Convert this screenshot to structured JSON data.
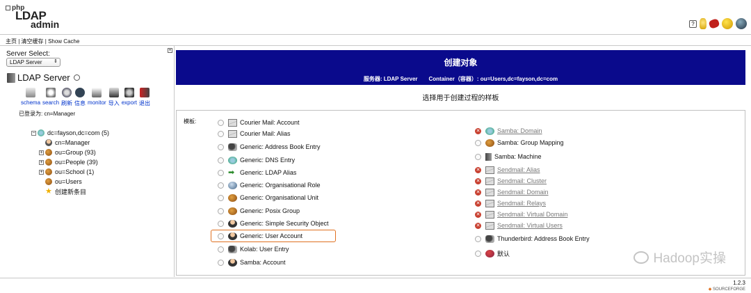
{
  "header": {
    "logo_line1": "php",
    "logo_line2": "LDAP",
    "logo_line3": "admin",
    "icons": [
      "help-icon",
      "bulb-icon",
      "bug-icon",
      "smile-icon",
      "support-icon"
    ]
  },
  "topnav": {
    "home": "主页",
    "sep1": " | ",
    "purge": "清空缓存",
    "sep2": " | ",
    "show_cache": "Show Cache"
  },
  "left": {
    "server_select_label": "Server Select:",
    "server_select_value": "LDAP Server",
    "server_name": "LDAP Server",
    "tools": [
      {
        "label": "schema",
        "icon": "schema-icon"
      },
      {
        "label": "search",
        "icon": "search-icon"
      },
      {
        "label": "刷新",
        "icon": "refresh-icon"
      },
      {
        "label": "信息",
        "icon": "info-icon"
      },
      {
        "label": "monitor",
        "icon": "monitor-icon"
      },
      {
        "label": "导入",
        "icon": "import-icon"
      },
      {
        "label": "export",
        "icon": "export-icon"
      },
      {
        "label": "退出",
        "icon": "logout-icon"
      }
    ],
    "logged_in": "已登录为: cn=Manager",
    "tree": {
      "root": "dc=fayson,dc=com (5)",
      "items": [
        {
          "label": "cn=Manager",
          "expandable": false,
          "icon": "user-icon"
        },
        {
          "label": "ou=Group (93)",
          "expandable": true,
          "icon": "group-icon"
        },
        {
          "label": "ou=People (39)",
          "expandable": true,
          "icon": "group-icon"
        },
        {
          "label": "ou=School (1)",
          "expandable": true,
          "icon": "group-icon"
        },
        {
          "label": "ou=Users",
          "expandable": false,
          "icon": "group-icon"
        },
        {
          "label": "创建新条目",
          "expandable": false,
          "icon": "star-icon"
        }
      ]
    }
  },
  "main": {
    "title": "创建对象",
    "server_info": "服务器: LDAP Server　　Container（容器）: ou=Users,dc=fayson,dc=com",
    "subtitle": "选择用于创建过程的样板",
    "template_label": "模板:",
    "left_templates": [
      {
        "label": "Courier Mail: Account",
        "icon": "mail-icon"
      },
      {
        "label": "Courier Mail: Alias",
        "icon": "mail-icon"
      },
      {
        "label": "Generic: Address Book Entry",
        "icon": "addressbook-icon"
      },
      {
        "label": "Generic: DNS Entry",
        "icon": "dns-icon"
      },
      {
        "label": "Generic: LDAP Alias",
        "icon": "arrow-icon"
      },
      {
        "label": "Generic: Organisational Role",
        "icon": "globe-icon"
      },
      {
        "label": "Generic: Organisational Unit",
        "icon": "group-icon"
      },
      {
        "label": "Generic: Posix Group",
        "icon": "group-icon"
      },
      {
        "label": "Generic: Simple Security Object",
        "icon": "user-icon"
      },
      {
        "label": "Generic: User Account",
        "icon": "user-icon"
      },
      {
        "label": "Kolab: User Entry",
        "icon": "addressbook-icon"
      },
      {
        "label": "Samba: Account",
        "icon": "user-icon"
      }
    ],
    "right_templates": [
      {
        "label": "Samba: Domain",
        "icon": "dns-icon",
        "disabled": true
      },
      {
        "label": "Samba: Group Mapping",
        "icon": "group-icon",
        "disabled": false
      },
      {
        "label": "Samba: Machine",
        "icon": "machine-icon",
        "disabled": false
      },
      {
        "label": "Sendmail: Alias",
        "icon": "mail-icon",
        "disabled": true
      },
      {
        "label": "Sendmail: Cluster",
        "icon": "mail-icon",
        "disabled": true
      },
      {
        "label": "Sendmail: Domain",
        "icon": "mail-icon",
        "disabled": true
      },
      {
        "label": "Sendmail: Relays",
        "icon": "mail-icon",
        "disabled": true
      },
      {
        "label": "Sendmail: Virtual Domain",
        "icon": "mail-icon",
        "disabled": true
      },
      {
        "label": "Sendmail: Virtual Users",
        "icon": "mail-icon",
        "disabled": true
      },
      {
        "label": "Thunderbird: Address Book Entry",
        "icon": "addressbook-icon",
        "disabled": false
      },
      {
        "label": "默认",
        "icon": "default-icon",
        "disabled": false
      }
    ],
    "highlighted_template": "Generic: User Account"
  },
  "footer": {
    "version": "1.2.3",
    "sourceforge": "SOURCEFORGE"
  },
  "watermark": {
    "text": "Hadoop实操"
  },
  "colors": {
    "header_bar": "#0a0a8c",
    "highlight": "#e07020",
    "disabled_mark": "#c84030"
  }
}
